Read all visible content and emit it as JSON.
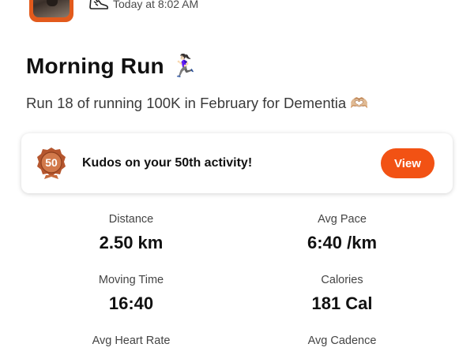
{
  "header": {
    "timestamp": "Today at 8:02 AM",
    "avatar_icon": "user-photo-avatar",
    "activity_icon": "shoe-icon"
  },
  "activity": {
    "title": "Morning Run 🏃🏻‍♀️",
    "description": "Run 18 of running 100K in February for Dementia 🫶🏼"
  },
  "kudos": {
    "message": "Kudos on your 50th activity!",
    "badge_number": "50",
    "button_label": "View",
    "accent_color": "#f25214"
  },
  "stats": [
    {
      "label": "Distance",
      "value": "2.50 km"
    },
    {
      "label": "Avg Pace",
      "value": "6:40 /km"
    },
    {
      "label": "Moving Time",
      "value": "16:40"
    },
    {
      "label": "Calories",
      "value": "181 Cal"
    },
    {
      "label": "Avg Heart Rate",
      "value": ""
    },
    {
      "label": "Avg Cadence",
      "value": ""
    }
  ]
}
